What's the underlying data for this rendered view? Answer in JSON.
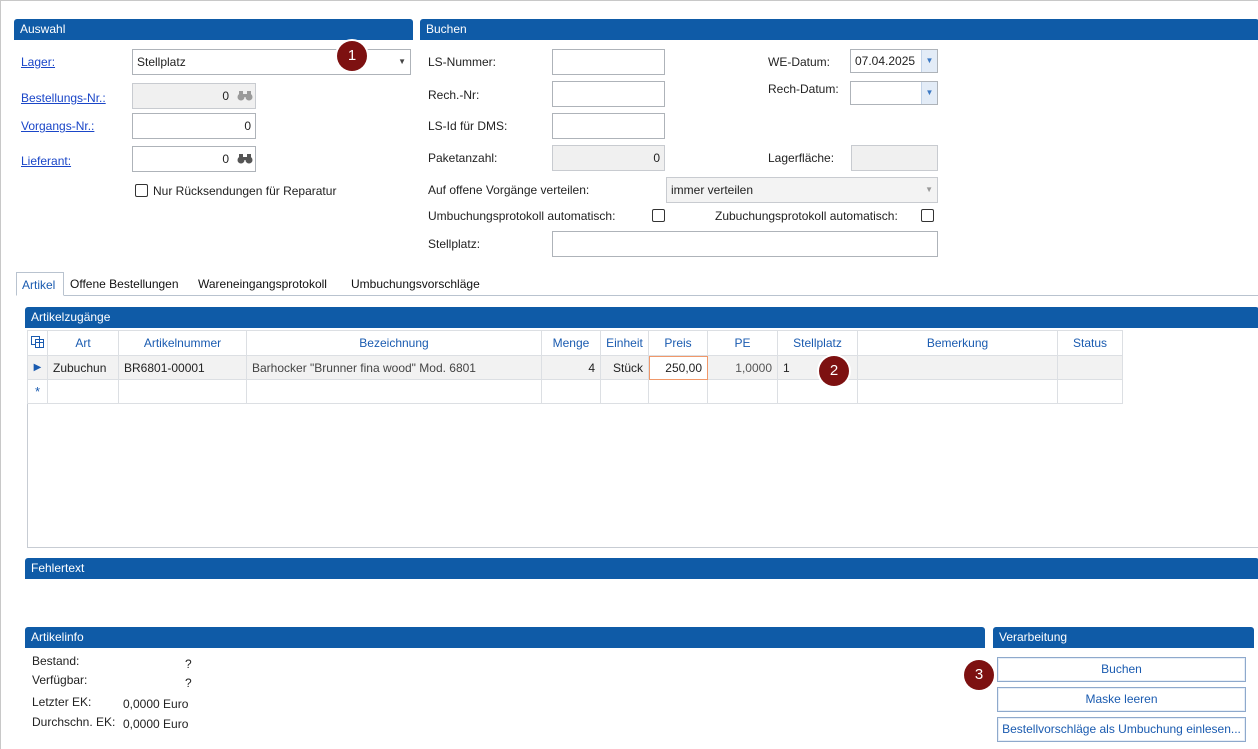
{
  "auswahl": {
    "title": "Auswahl",
    "lager_label": "Lager:",
    "lager_value": "Stellplatz",
    "bestellnr_label": "Bestellungs-Nr.:",
    "bestellnr_value": "0",
    "vorgangsnr_label": "Vorgangs-Nr.:",
    "vorgangsnr_value": "0",
    "lieferant_label": "Lieferant:",
    "lieferant_value": "0",
    "ruecksendungen_label": "Nur Rücksendungen für Reparatur"
  },
  "buchen": {
    "title": "Buchen",
    "ls_nummer_label": "LS-Nummer:",
    "ls_nummer_value": "",
    "rech_nr_label": "Rech.-Nr:",
    "rech_nr_value": "",
    "ls_id_label": "LS-Id für DMS:",
    "ls_id_value": "",
    "paketanzahl_label": "Paketanzahl:",
    "paketanzahl_value": "0",
    "we_datum_label": "WE-Datum:",
    "we_datum_value": "07.04.2025",
    "rech_datum_label": "Rech-Datum:",
    "rech_datum_value": "",
    "lagerflaeche_label": "Lagerfläche:",
    "lagerflaeche_value": "",
    "verteilen_label": "Auf offene Vorgänge verteilen:",
    "verteilen_value": "immer verteilen",
    "umbuchung_label": "Umbuchungsprotokoll automatisch:",
    "zubuchung_label": "Zubuchungsprotokoll automatisch:",
    "stellplatz_label": "Stellplatz:",
    "stellplatz_value": ""
  },
  "tabs": [
    "Artikel",
    "Offene Bestellungen",
    "Wareneingangsprotokoll",
    "Umbuchungsvorschläge"
  ],
  "artikelzugaenge": {
    "title": "Artikelzugänge",
    "columns": [
      "Art",
      "Artikelnummer",
      "Bezeichnung",
      "Menge",
      "Einheit",
      "Preis",
      "PE",
      "Stellplatz",
      "Bemerkung",
      "Status"
    ],
    "rows": [
      {
        "art": "Zubuchun",
        "artikelnummer": "BR6801-00001",
        "bezeichnung": "Barhocker \"Brunner fina wood\" Mod. 6801",
        "menge": "4",
        "einheit": "Stück",
        "preis": "250,00",
        "pe": "1,0000",
        "stellplatz": "1",
        "bemerkung": "",
        "status": ""
      }
    ],
    "new_row_marker": "*",
    "current_row_marker": "▶"
  },
  "fehlertext": {
    "title": "Fehlertext",
    "text": ""
  },
  "artikelinfo": {
    "title": "Artikelinfo",
    "bestand_label": "Bestand:",
    "bestand_value": "?",
    "verfuegbar_label": "Verfügbar:",
    "verfuegbar_value": "?",
    "letzter_ek_label": "Letzter EK:",
    "letzter_ek_value": "0,0000 Euro",
    "durchschn_ek_label": "Durchschn. EK:",
    "durchschn_ek_value": "0,0000 Euro"
  },
  "verarbeitung": {
    "title": "Verarbeitung",
    "buchen_button": "Buchen",
    "maske_button": "Maske leeren",
    "bestellvorschlaege_button": "Bestellvorschläge als Umbuchung einlesen..."
  },
  "badges": [
    "1",
    "2",
    "3"
  ],
  "colors": {
    "header_blue": "#0f5ba7",
    "badge": "#7d1111",
    "link": "#1a46c8"
  }
}
